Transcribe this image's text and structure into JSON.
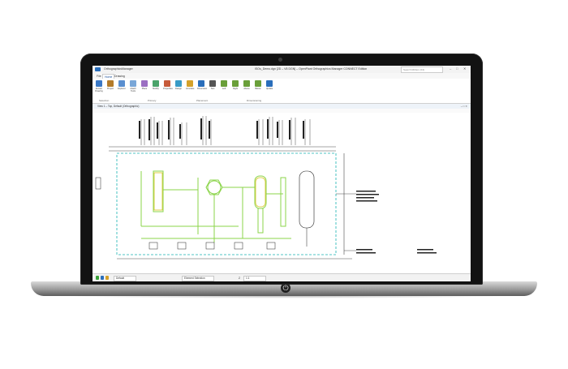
{
  "app": {
    "name": "OrthographicsManager",
    "window_title": "ISOs_Demo.dgn [2D – V8 DGN] – OpenPlant Orthographics Manager CONNECT Edition",
    "search_placeholder": "Search Ribbon (F4)",
    "min": "–",
    "max": "□",
    "close": "✕"
  },
  "tabs": [
    "File",
    "Home",
    "Drawing"
  ],
  "ribbon": {
    "buttons": [
      {
        "label": "Extract Drawing",
        "icon": "extract-icon",
        "color": "#3a78c6"
      },
      {
        "label": "Project",
        "icon": "project-icon",
        "color": "#b37b2a"
      },
      {
        "label": "Explorer",
        "icon": "explorer-icon",
        "color": "#5a8fd0"
      },
      {
        "label": "Attach Tools",
        "icon": "attach-icon",
        "color": "#7aa7d8"
      },
      {
        "label": "Place",
        "icon": "place-icon",
        "color": "#9b6fc2"
      },
      {
        "label": "Modify",
        "icon": "modify-icon",
        "color": "#4aa36a"
      },
      {
        "label": "Properties",
        "icon": "properties-icon",
        "color": "#c65a3a"
      },
      {
        "label": "Design",
        "icon": "design-icon",
        "color": "#3a9bc6"
      },
      {
        "label": "Annotate",
        "icon": "annotate-icon",
        "color": "#d4a12a"
      },
      {
        "label": "Dimension",
        "icon": "dimension-icon",
        "color": "#2a6ebb"
      },
      {
        "label": "Text",
        "icon": "text-icon",
        "color": "#555555"
      },
      {
        "label": "Left",
        "icon": "left-icon",
        "color": "#6a9f3a"
      },
      {
        "label": "Right",
        "icon": "right-icon",
        "color": "#6a9f3a"
      },
      {
        "label": "Above",
        "icon": "above-icon",
        "color": "#6a9f3a"
      },
      {
        "label": "Below",
        "icon": "below-icon",
        "color": "#6a9f3a"
      },
      {
        "label": "Update",
        "icon": "update-icon",
        "color": "#2a6ebb"
      }
    ],
    "groups": [
      "Selection",
      "Primary",
      "Placement",
      "Dimensioning"
    ]
  },
  "view": {
    "title": "View 1 – Top, Default (Orthographic)",
    "buttons": "– □ ✕"
  },
  "statusbar": {
    "level_field": "Default",
    "tool_field": "Element Selection",
    "coord_label": "Z",
    "zoom_field": "1:1",
    "colors": {
      "green": "#3aa23a",
      "blue": "#2a6ebb",
      "orange": "#d4a12a"
    }
  },
  "drawing": {
    "colors": {
      "line": "#222222",
      "equipment": "#8bd44a",
      "highlight": "#d4c21a",
      "border": "#19b3b3"
    }
  }
}
